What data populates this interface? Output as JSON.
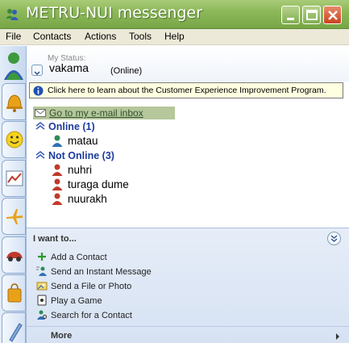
{
  "window": {
    "title": "METRU-NUI messenger"
  },
  "menu": {
    "items": [
      "File",
      "Contacts",
      "Actions",
      "Tools",
      "Help"
    ]
  },
  "status": {
    "label": "My Status:",
    "name": "vakama",
    "state": "(Online)"
  },
  "infobar": {
    "text": "Click here to learn about the Customer Experience Improvement Program."
  },
  "contacts": {
    "inbox_link": "Go to my e-mail inbox",
    "groups": [
      {
        "header": "Online (1)",
        "members": [
          "matau"
        ],
        "status_color": "#2e8b57"
      },
      {
        "header": "Not Online (3)",
        "members": [
          "nuhri",
          "turaga dume",
          "nuurakh"
        ],
        "status_color": "#c0392b"
      }
    ]
  },
  "tasks_panel": {
    "title": "I want to...",
    "items": [
      {
        "label": "Add a Contact",
        "icon": "plus-icon"
      },
      {
        "label": "Send an Instant Message",
        "icon": "message-icon"
      },
      {
        "label": "Send a File or Photo",
        "icon": "file-photo-icon"
      },
      {
        "label": "Play a Game",
        "icon": "game-icon"
      },
      {
        "label": "Search for a Contact",
        "icon": "search-contact-icon"
      }
    ],
    "more_label": "More"
  },
  "colors": {
    "titlebar": "#8db85a",
    "group_header": "#1b3b9b",
    "infobar_bg": "#ffffe1"
  }
}
